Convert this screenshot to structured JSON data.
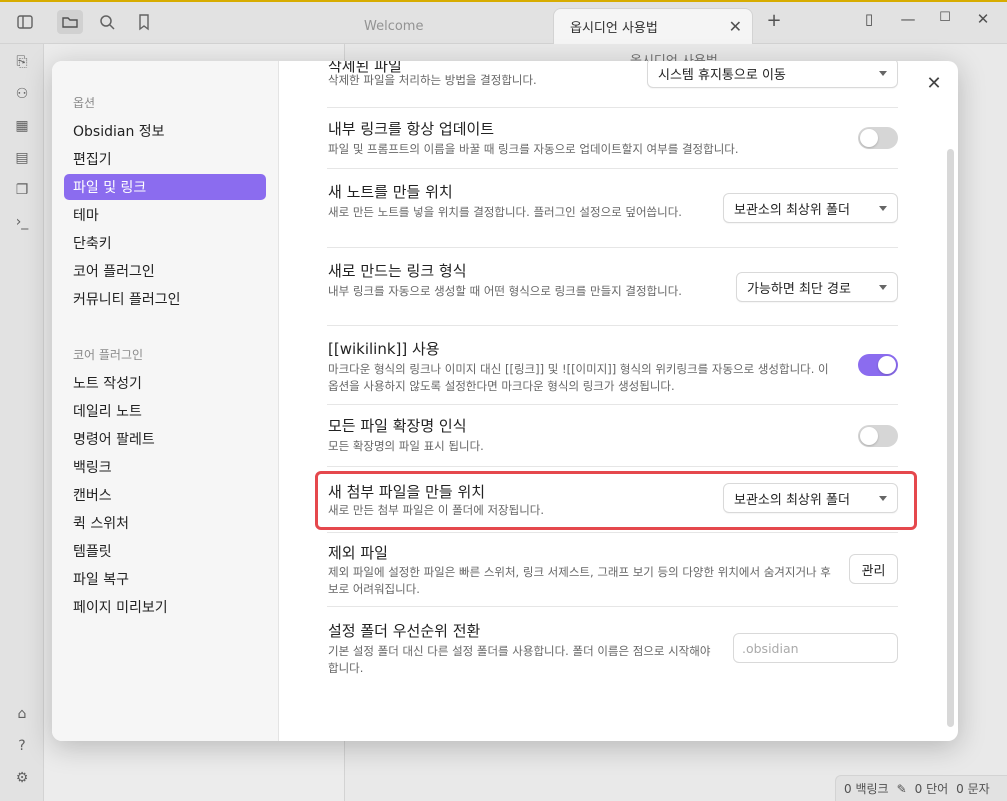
{
  "titlebar": {
    "tabs": [
      {
        "label": "Welcome"
      },
      {
        "label": "옵시디언 사용법"
      }
    ],
    "doc_title": "옵시디언 사용법"
  },
  "statusbar": {
    "backlinks": "0 백링크",
    "words": "0 단어",
    "chars": "0 문자"
  },
  "sidebar": {
    "section_options": "옵션",
    "options": [
      {
        "label": "Obsidian 정보"
      },
      {
        "label": "편집기"
      },
      {
        "label": "파일 및 링크"
      },
      {
        "label": "테마"
      },
      {
        "label": "단축키"
      },
      {
        "label": "코어 플러그인"
      },
      {
        "label": "커뮤니티 플러그인"
      }
    ],
    "section_core": "코어 플러그인",
    "core": [
      {
        "label": "노트 작성기"
      },
      {
        "label": "데일리 노트"
      },
      {
        "label": "명령어 팔레트"
      },
      {
        "label": "백링크"
      },
      {
        "label": "캔버스"
      },
      {
        "label": "퀵 스위처"
      },
      {
        "label": "템플릿"
      },
      {
        "label": "파일 복구"
      },
      {
        "label": "페이지 미리보기"
      }
    ]
  },
  "settings": {
    "deleted": {
      "name": "삭제된 파일",
      "desc": "삭제한 파일을 처리하는 방법을 결정합니다.",
      "value": "시스템 휴지통으로 이동"
    },
    "update_links": {
      "name": "내부 링크를 항상 업데이트",
      "desc": "파일 및 프롬프트의 이름을 바꿀 때 링크를 자동으로 업데이트할지 여부를 결정합니다.",
      "enabled": false
    },
    "new_note": {
      "name": "새 노트를 만들 위치",
      "desc": "새로 만든 노트를 넣을 위치를 결정합니다. 플러그인 설정으로 덮어씁니다.",
      "value": "보관소의 최상위 폴더"
    },
    "link_format": {
      "name": "새로 만드는 링크 형식",
      "desc": "내부 링크를 자동으로 생성할 때 어떤 형식으로 링크를 만들지 결정합니다.",
      "value": "가능하면 최단 경로"
    },
    "wikilink": {
      "name": "[[wikilink]] 사용",
      "desc": "마크다운 형식의 링크나 이미지 대신 [[링크]] 및 ![[이미지]] 형식의 위키링크를 자동으로 생성합니다. 이 옵션을 사용하지 않도록 설정한다면 마크다운 형식의 링크가 생성됩니다.",
      "enabled": true
    },
    "all_ext": {
      "name": "모든 파일 확장명 인식",
      "desc": "모든 확장명의 파일 표시 됩니다.",
      "enabled": false
    },
    "attachment": {
      "name": "새 첨부 파일을 만들 위치",
      "desc": "새로 만든 첨부 파일은 이 폴더에 저장됩니다.",
      "value": "보관소의 최상위 폴더"
    },
    "excluded": {
      "name": "제외 파일",
      "desc": "제외 파일에 설정한 파일은 빠른 스위처, 링크 서제스트, 그래프 보기 등의 다양한 위치에서 숨겨지거나 후보로 어려워집니다.",
      "button": "관리"
    },
    "config_folder": {
      "name": "설정 폴더 우선순위 전환",
      "desc": "기본 설정 폴더 대신 다른 설정 폴더를 사용합니다. 폴더 이름은 점으로 시작해야 합니다.",
      "placeholder": ".obsidian"
    }
  },
  "colors": {
    "accent": "#8b6cef",
    "highlight": "#e5484d"
  }
}
